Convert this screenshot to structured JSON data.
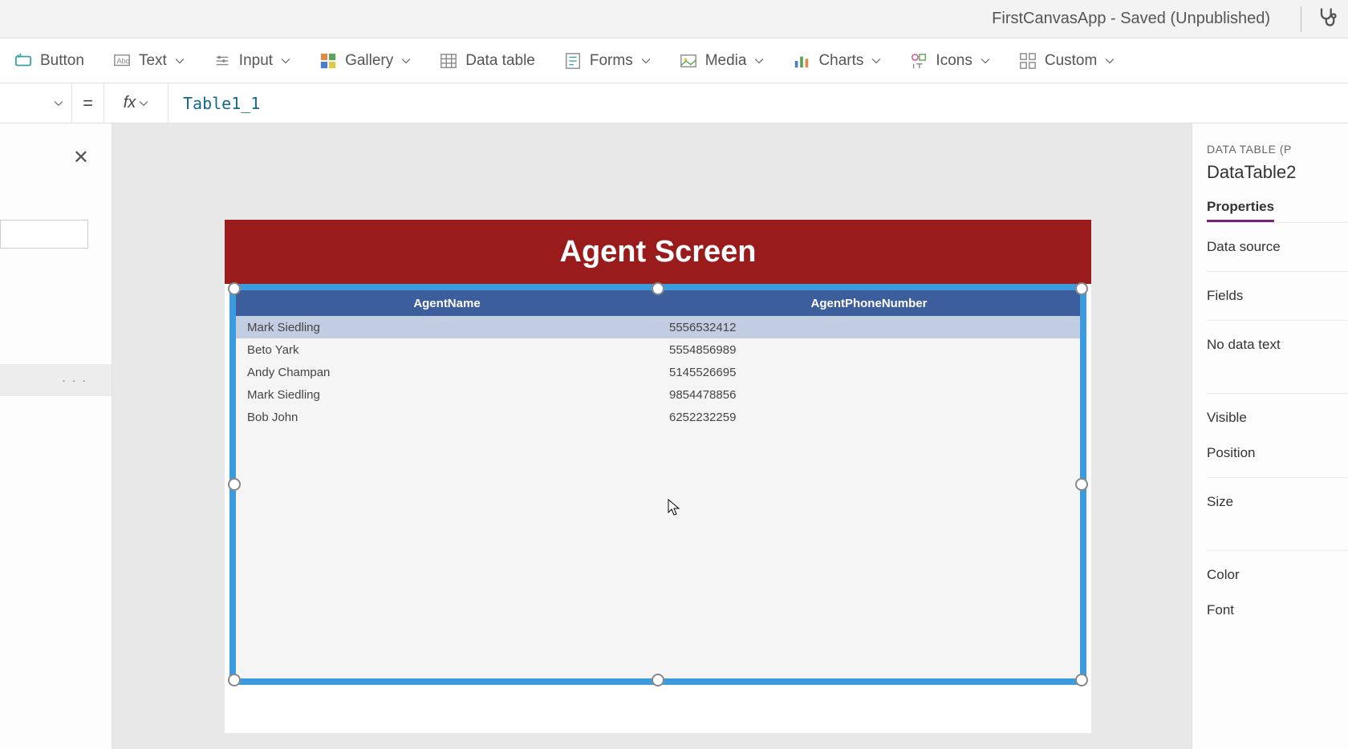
{
  "title_bar": {
    "app_title": "FirstCanvasApp - Saved (Unpublished)"
  },
  "ribbon": {
    "button": "Button",
    "text": "Text",
    "input": "Input",
    "gallery": "Gallery",
    "data_table": "Data table",
    "forms": "Forms",
    "media": "Media",
    "charts": "Charts",
    "icons": "Icons",
    "custom": "Custom"
  },
  "formula_bar": {
    "equals": "=",
    "fx": "fx",
    "value": "Table1_1"
  },
  "left_panel": {
    "tree_more": "· · ·"
  },
  "canvas": {
    "screen_title": "Agent Screen",
    "table": {
      "columns": [
        "AgentName",
        "AgentPhoneNumber"
      ],
      "rows": [
        {
          "name": "Mark Siedling",
          "phone": "5556532412"
        },
        {
          "name": "Beto Yark",
          "phone": "5554856989"
        },
        {
          "name": "Andy Champan",
          "phone": "5145526695"
        },
        {
          "name": "Mark Siedling",
          "phone": "9854478856"
        },
        {
          "name": "Bob John",
          "phone": "6252232259"
        }
      ]
    }
  },
  "right_panel": {
    "caption": "DATA TABLE (P",
    "control_name": "DataTable2",
    "tab_properties": "Properties",
    "data_source": "Data source",
    "fields": "Fields",
    "no_data_text": "No data text",
    "visible": "Visible",
    "position": "Position",
    "size": "Size",
    "color": "Color",
    "font": "Font"
  }
}
